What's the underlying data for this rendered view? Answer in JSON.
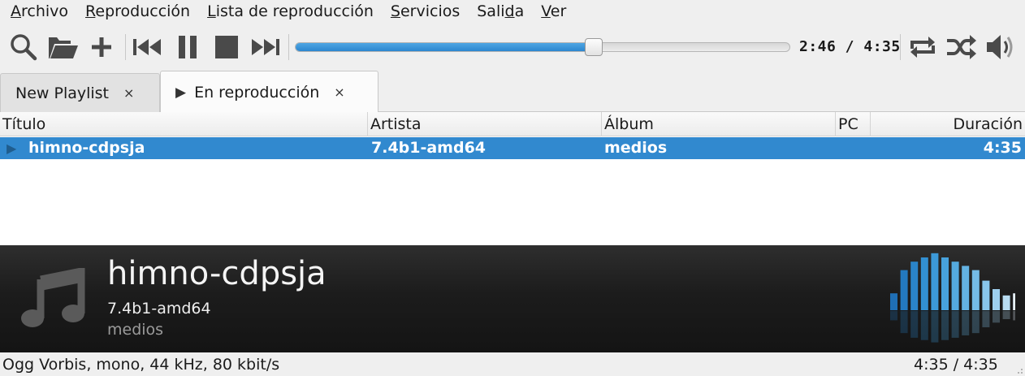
{
  "menubar": {
    "items": [
      {
        "mnemonic": "A",
        "rest": "rchivo"
      },
      {
        "mnemonic": "R",
        "rest": "eproducción"
      },
      {
        "mnemonic": "L",
        "rest": "ista de reproducción"
      },
      {
        "mnemonic": "S",
        "rest": "ervicios"
      },
      {
        "pre": "Sali",
        "mnemonic": "d",
        "rest": "a"
      },
      {
        "mnemonic": "V",
        "rest": "er"
      }
    ]
  },
  "toolbar": {
    "icons": [
      "search-icon",
      "open-folder-icon",
      "add-icon",
      "previous-icon",
      "pause-icon",
      "stop-icon",
      "next-icon",
      "repeat-icon",
      "shuffle-icon",
      "volume-icon"
    ],
    "progress": 0.604,
    "time_label": "2:46 / 4:35"
  },
  "tabs": [
    {
      "label": "New Playlist",
      "close": "×",
      "active": false
    },
    {
      "label": "En reproducción",
      "close": "×",
      "active": true,
      "playing": true
    }
  ],
  "table": {
    "columns": [
      "Título",
      "Artista",
      "Álbum",
      "PC",
      "Duración"
    ],
    "rows": [
      {
        "title": "himno-cdpsja",
        "artist": "7.4b1-amd64",
        "album": "medios",
        "pc": "",
        "duration": "4:35",
        "selected": true,
        "playing": true
      }
    ]
  },
  "now_playing": {
    "title": "himno-cdpsja",
    "artist": "7.4b1-amd64",
    "album": "medios",
    "visualizer_levels": [
      0.16,
      0.38,
      0.46,
      0.5,
      0.54,
      0.5,
      0.46,
      0.42,
      0.38,
      0.28,
      0.2,
      0.14,
      0.16
    ]
  },
  "statusbar": {
    "format": "Ogg Vorbis, mono, 44 kHz, 80 kbit/s",
    "time": "4:35 / 4:35"
  },
  "colors": {
    "accent": "#3189cf",
    "panel_dark": "#1c1c1c"
  }
}
